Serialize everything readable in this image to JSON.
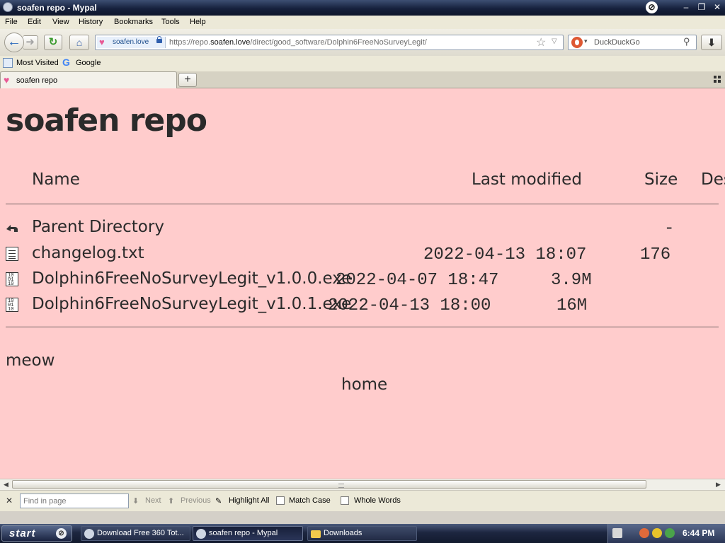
{
  "window": {
    "title": "soafen repo - Mypal"
  },
  "menu": [
    "File",
    "Edit",
    "View",
    "History",
    "Bookmarks",
    "Tools",
    "Help"
  ],
  "nav": {
    "site_identity": "soafen.love",
    "url_prefix": "https://repo.",
    "url_domain": "soafen.love",
    "url_path": "/direct/good_software/Dolphin6FreeNoSurveyLegit/",
    "search_placeholder": "DuckDuckGo"
  },
  "bookmarks": [
    "Most Visited",
    "Google"
  ],
  "tabs": [
    {
      "label": "soafen repo",
      "active": true
    }
  ],
  "content": {
    "title": "soafen repo",
    "columns": {
      "name": "Name",
      "last_modified": "Last modified",
      "size": "Size",
      "description": "Des"
    },
    "parent": {
      "name": "Parent Directory",
      "size": "-"
    },
    "files": [
      {
        "name": "changelog.txt",
        "date": "2022-04-13 18:07",
        "size": "176",
        "icon": "text-file-icon"
      },
      {
        "name": "Dolphin6FreeNoSurveyLegit_v1.0.0.exe",
        "date": "2022-04-07 18:47",
        "size": "3.9M",
        "icon": "binary-file-icon"
      },
      {
        "name": "Dolphin6FreeNoSurveyLegit_v1.0.1.exe",
        "date": "2022-04-13 18:00",
        "size": "16M",
        "icon": "binary-file-icon"
      }
    ],
    "footer_text": "meow",
    "footer_link": "home"
  },
  "findbar": {
    "placeholder": "Find in page",
    "next": "Next",
    "previous": "Previous",
    "highlight_all": "Highlight All",
    "match_case": "Match Case",
    "whole_words": "Whole Words"
  },
  "taskbar": {
    "start": "start",
    "tasks": [
      {
        "label": "Download Free 360 Tot...",
        "active": false
      },
      {
        "label": "soafen repo - Mypal",
        "active": true
      },
      {
        "label": "Downloads",
        "active": false
      }
    ],
    "clock": "6:44 PM"
  },
  "colors": {
    "page_background": "#ffcccc",
    "title_bar": "#16213d",
    "text": "#2a2a2a"
  }
}
